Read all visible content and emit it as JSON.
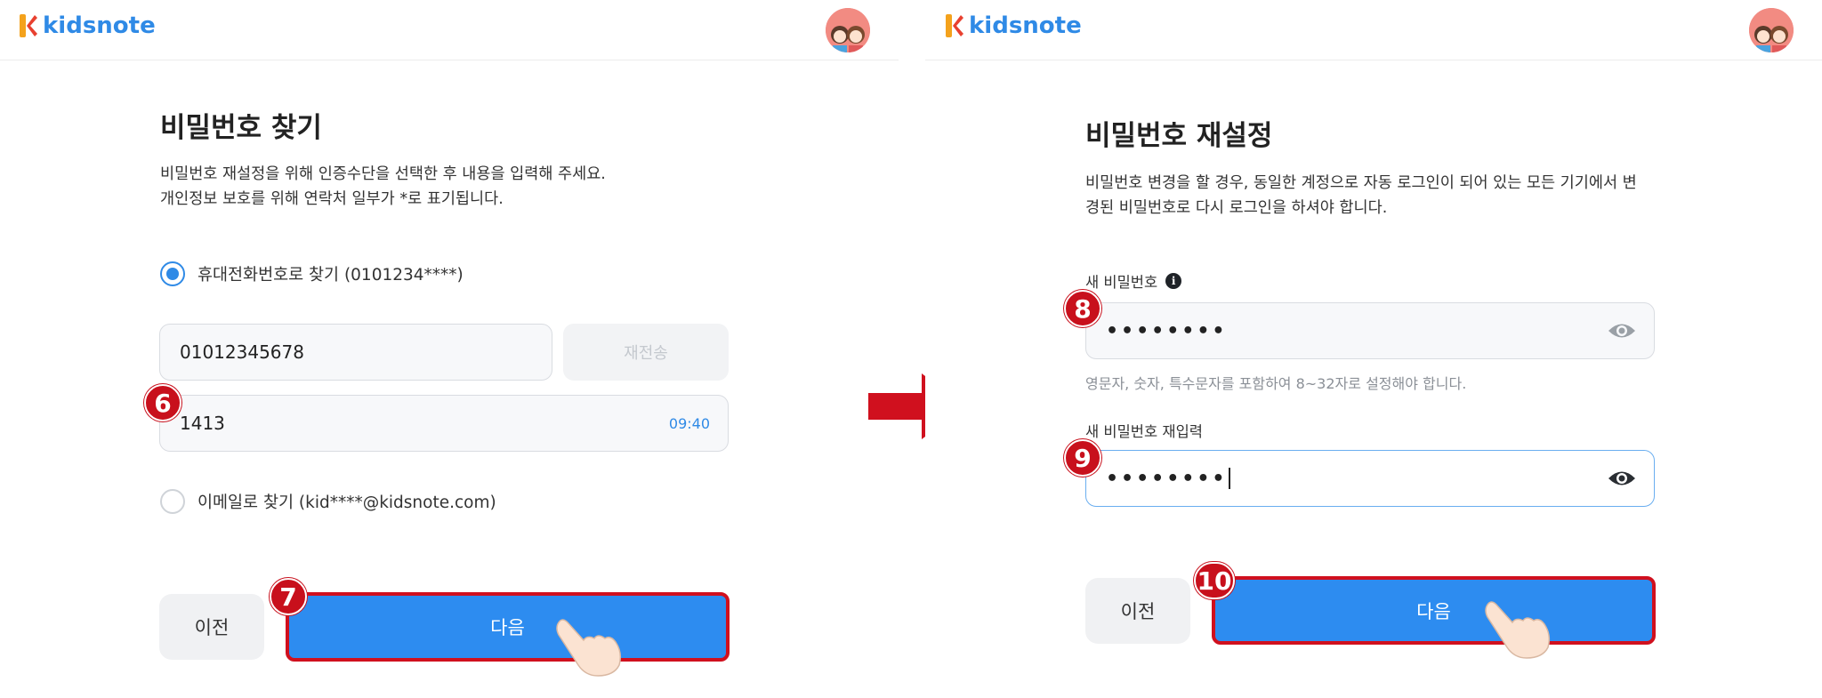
{
  "brand": {
    "name": "kidsnote",
    "color": "#2f8ae6"
  },
  "left": {
    "title": "비밀번호 찾기",
    "description": "비밀번호 재설정을 위해 인증수단을 선택한 후 내용을 입력해 주세요.\n개인정보 보호를 위해 연락처 일부가 *로 표기됩니다.",
    "option_phone": "휴대전화번호로 찾기 (0101234****)",
    "option_email": "이메일로 찾기 (kid****@kidsnote.com)",
    "phone_value": "01012345678",
    "resend_label": "재전송",
    "code_value": "1413",
    "timer": "09:40",
    "prev_label": "이전",
    "next_label": "다음",
    "step_code": "6",
    "step_next": "7"
  },
  "right": {
    "title": "비밀번호 재설정",
    "description": "비밀번호 변경을 할 경우, 동일한 계정으로 자동 로그인이 되어 있는 모든 기기에서 변\n경된 비밀번호로 다시 로그인을 하셔야 합니다.",
    "new_password_label": "새 비밀번호",
    "new_password_value": "••••••••",
    "password_hint": "영문자, 숫자, 특수문자를 포함하여 8~32자로 설정해야 합니다.",
    "confirm_password_label": "새 비밀번호 재입력",
    "confirm_password_value": "••••••••",
    "prev_label": "이전",
    "next_label": "다음",
    "step_new": "8",
    "step_confirm": "9",
    "step_next": "10"
  },
  "colors": {
    "accent": "#2d8cf0",
    "highlight_border": "#d0101e",
    "arrow": "#d0101e"
  }
}
